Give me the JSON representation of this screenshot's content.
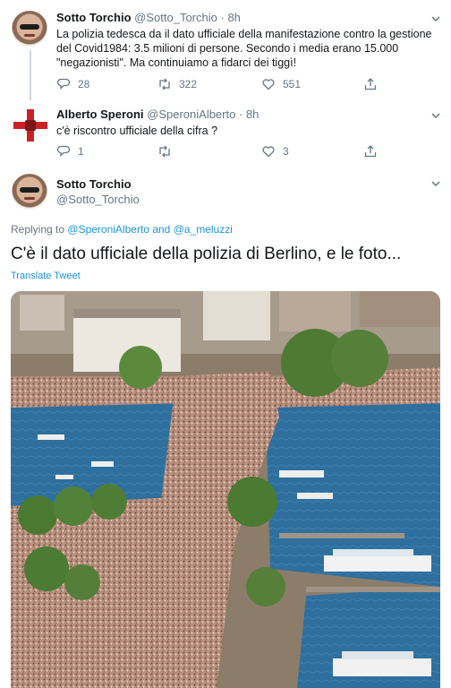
{
  "tweet1": {
    "name": "Sotto Torchio",
    "handle": "@Sotto_Torchio",
    "separator": "·",
    "time": "8h",
    "text": "La polizia tedesca da il dato ufficiale della manifestazione contro la gestione del Covid1984: 3.5 milioni di persone. Secondo i media erano 15.000 \"negazionisti\". Ma continuiamo a fidarci dei tiggì!",
    "replies": "28",
    "retweets": "322",
    "likes": "551"
  },
  "tweet2": {
    "name": "Alberto Speroni",
    "handle": "@SperoniAlberto",
    "separator": "·",
    "time": "8h",
    "text": "c'è riscontro ufficiale della cifra ?",
    "replies": "1",
    "retweets": "",
    "likes": "3"
  },
  "tweet3": {
    "name": "Sotto Torchio",
    "handle": "@Sotto_Torchio",
    "replying_prefix": "Replying to",
    "replying_user1": "@SperoniAlberto",
    "replying_and": "and",
    "replying_user2": "@a_meluzzi",
    "text": "C'è il dato ufficiale della polizia di Berlino, e le foto...",
    "translate": "Translate Tweet"
  },
  "icons": {
    "reply": "reply-icon",
    "retweet": "retweet-icon",
    "like": "heart-icon",
    "share": "share-icon",
    "more": "chevron-down-icon"
  },
  "colors": {
    "link": "#1b95e0",
    "muted": "#657786",
    "text": "#14171a",
    "thread_line": "#ccd6dd"
  }
}
